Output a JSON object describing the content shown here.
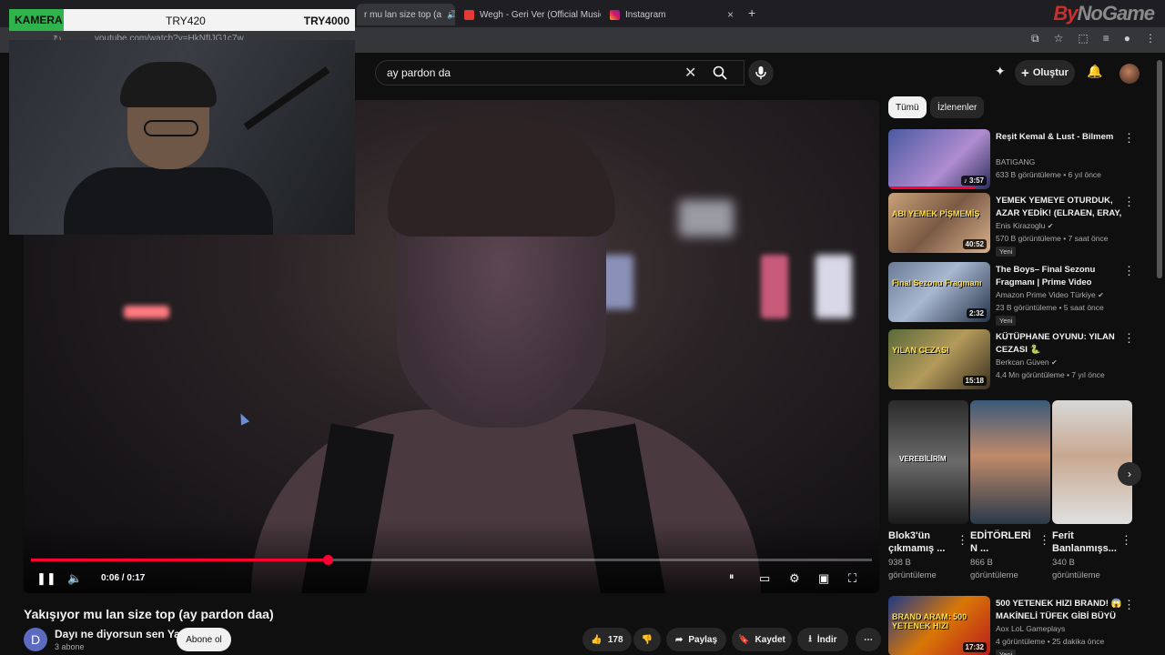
{
  "browser": {
    "tabs": [
      {
        "label": "r mu lan size top (a",
        "active": true
      },
      {
        "label": "Wegh - Geri Ver (Official Music",
        "active": false
      },
      {
        "label": "Instagram",
        "active": false
      }
    ],
    "url": "youtube.com/watch?v=HkNfIJG1c7w",
    "brand_left": "By",
    "brand_right": "NoGame"
  },
  "overlay": {
    "camera_label": "KAMERA",
    "tier1": "TRY420",
    "tier2": "TRY4000"
  },
  "header": {
    "search_value": "ay pardon da",
    "create_label": "Oluştur"
  },
  "player": {
    "time_current": "0:06",
    "time_total": "0:17",
    "time_display": "0:06 / 0:17",
    "progress_fraction": 0.353,
    "colors": {
      "progress": "#ff0033"
    }
  },
  "video": {
    "title": "Yakışıyor mu lan size top (ay pardon daa)",
    "channel_name": "Dayı ne diyorsun sen Yaa",
    "channel_initial": "D",
    "subscribers": "3 abone",
    "subscribe_label": "Abone ol",
    "likes": "178",
    "share_label": "Paylaş",
    "save_label": "Kaydet",
    "download_label": "İndir"
  },
  "sidebar": {
    "chips": [
      "Tümü",
      "İzlenenler"
    ],
    "recommendations": [
      {
        "title": "Reşit Kemal & Lust - Bilmem",
        "channel": "BATIGANG",
        "meta": "633 B görüntüleme • 6 yıl önce",
        "duration": "3:57",
        "badge": "",
        "verified": false,
        "music": true,
        "watched": 0.85
      },
      {
        "title": "YEMEK YEMEYE OTURDUK, AZAR YEDİK! (ELRAEN, ERAY, ...",
        "channel": "Enis Kirazoglu",
        "meta": "570 B görüntüleme • 7 saat önce",
        "duration": "40:52",
        "badge": "Yeni",
        "verified": true,
        "music": false,
        "watched": 0
      },
      {
        "title": "The Boys– Final Sezonu Fragmanı | Prime Video Türkiye",
        "channel": "Amazon Prime Video Türkiye",
        "meta": "23 B görüntüleme • 5 saat önce",
        "duration": "2:32",
        "badge": "Yeni",
        "verified": true,
        "music": false,
        "watched": 0
      },
      {
        "title": "KÜTÜPHANE OYUNU: YILAN CEZASI 🐍",
        "channel": "Berkcan Güven",
        "meta": "4,4 Mn görüntüleme • 7 yıl önce",
        "duration": "15:18",
        "badge": "",
        "verified": true,
        "music": false,
        "watched": 0
      },
      {
        "title": "500 YETENEK HIZI BRAND! 😱 MAKİNELİ TÜFEK GİBİ BÜYÜ ...",
        "channel": "Aox LoL Gameplays",
        "meta": "4 görüntüleme • 25 dakika önce",
        "duration": "17:32",
        "badge": "Yeni",
        "verified": false,
        "music": false,
        "watched": 0
      }
    ],
    "thumb_texts": [
      "",
      "ABI YEMEK PİŞMEMİŞ",
      "Final Sezonu Fragmanı",
      "YILAN CEZASI",
      "BRAND ARAM: 500 YETENEK HIZI"
    ],
    "shorts": [
      {
        "title": "Blok3'ün çıkmamış ...",
        "views": "938 B görüntüleme",
        "overlay": "VEREBİLİRİM"
      },
      {
        "title": "EDİTÖRLERİ N ...",
        "views": "866 B görüntüleme",
        "overlay": ""
      },
      {
        "title": "Ferit Banlanmışs...",
        "views": "340 B görüntüleme",
        "overlay": ""
      }
    ]
  }
}
